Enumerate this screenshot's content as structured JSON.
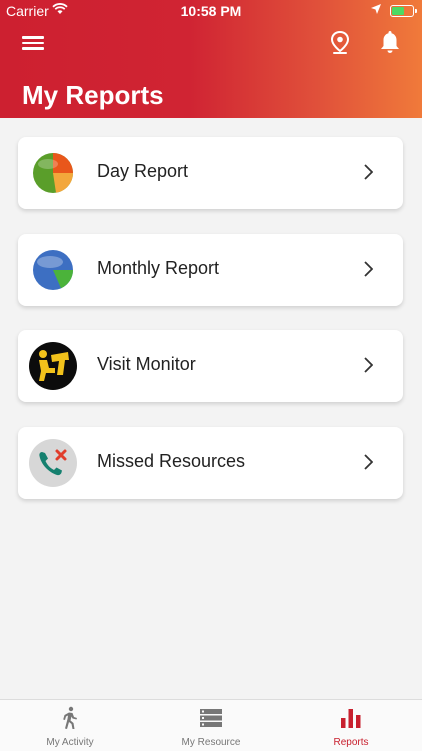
{
  "status_bar": {
    "carrier": "Carrier",
    "time": "10:58 PM"
  },
  "header": {
    "title": "My Reports",
    "icons": [
      "menu-icon",
      "location-pin-icon",
      "bell-icon"
    ]
  },
  "reports": [
    {
      "label": "Day Report",
      "icon": "pie-chart-orange-icon"
    },
    {
      "label": "Monthly Report",
      "icon": "pie-chart-blue-icon"
    },
    {
      "label": "Visit Monitor",
      "icon": "visit-monitor-icon"
    },
    {
      "label": "Missed Resources",
      "icon": "missed-call-icon"
    }
  ],
  "tabbar": {
    "tabs": [
      {
        "label": "My Activity",
        "icon": "walking-person-icon",
        "active": false
      },
      {
        "label": "My Resource",
        "icon": "server-list-icon",
        "active": false
      },
      {
        "label": "Reports",
        "icon": "bar-chart-icon",
        "active": true
      }
    ]
  },
  "colors": {
    "primary": "#c8202e",
    "gradient_end": "#f07a3a",
    "background": "#f3f3f3"
  }
}
